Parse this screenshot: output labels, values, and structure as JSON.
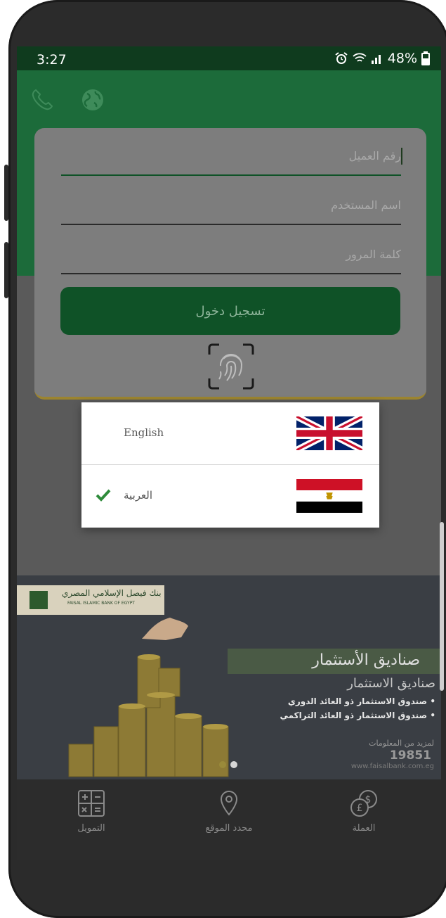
{
  "status_bar": {
    "time": "3:27",
    "battery": "48%",
    "icons": [
      "alarm-icon",
      "wifi-icon",
      "signal-icon",
      "battery-icon"
    ]
  },
  "header": {
    "icons": [
      "phone-icon",
      "globe-icon"
    ]
  },
  "login_form": {
    "customer_number_placeholder": "رقم العميل",
    "username_placeholder": "اسم المستخدم",
    "password_placeholder": "كلمة المرور",
    "login_button": "تسجيل دخول",
    "fingerprint_icon": "fingerprint-icon"
  },
  "language_dialog": {
    "options": [
      {
        "label": "English",
        "flag": "uk-flag",
        "selected": false
      },
      {
        "label": "العربية",
        "flag": "egypt-flag",
        "selected": true
      }
    ]
  },
  "banner": {
    "bank_name_ar": "بنك فيصل الإسلامي المصري",
    "bank_name_en": "FAISAL ISLAMIC BANK OF EGYPT",
    "headline": "صناديق الأستثمار",
    "subheadline": "صناديق الاستثمار",
    "bullets": [
      "• صندوق الاستثمار ذو العائد الدوري",
      "• صندوق الاستثمار ذو العائد التراكمي"
    ],
    "more_info": "لمزيد من المعلومات",
    "hotline": "19851",
    "website": "www.faisalbank.com.eg",
    "slide_count": 2,
    "active_slide": 2
  },
  "bottom_nav": {
    "items": [
      {
        "label": "التمويل",
        "icon": "calculator-icon"
      },
      {
        "label": "محدد الموقع",
        "icon": "location-pin-icon"
      },
      {
        "label": "العملة",
        "icon": "currency-icon"
      }
    ]
  },
  "colors": {
    "green": "#1c6b3a",
    "dark_green": "#0f5227",
    "gold": "#9b8430",
    "check": "#2e8b3a"
  }
}
